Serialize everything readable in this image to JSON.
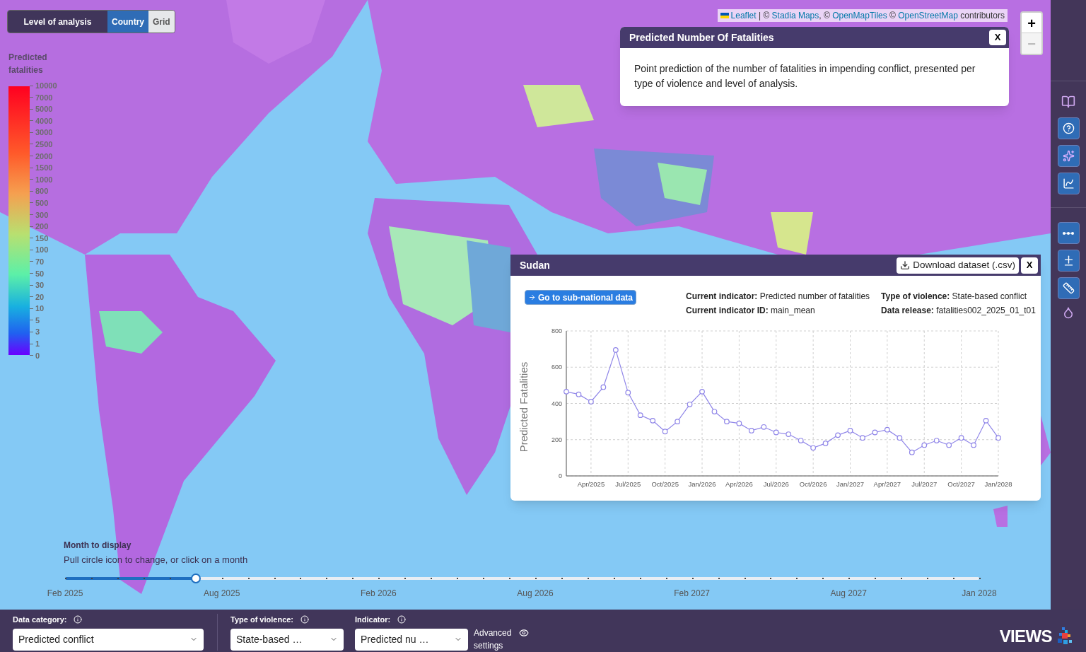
{
  "level_toggle": {
    "label": "Level of analysis",
    "options": [
      {
        "label": "Country",
        "selected": true
      },
      {
        "label": "Grid",
        "selected": false
      }
    ]
  },
  "legend": {
    "title": "Predicted fatalities",
    "labels": [
      "10000",
      "7000",
      "5000",
      "4000",
      "3000",
      "2500",
      "2000",
      "1500",
      "1000",
      "800",
      "500",
      "300",
      "200",
      "150",
      "100",
      "70",
      "50",
      "30",
      "20",
      "10",
      "5",
      "3",
      "1",
      "0"
    ]
  },
  "attribution": [
    {
      "kind": "link",
      "text": "Leaflet"
    },
    {
      "kind": "text",
      "text": " | © "
    },
    {
      "kind": "link",
      "text": "Stadia Maps"
    },
    {
      "kind": "text",
      "text": ", © "
    },
    {
      "kind": "link",
      "text": "OpenMapTiles"
    },
    {
      "kind": "text",
      "text": " © "
    },
    {
      "kind": "link",
      "text": "OpenStreetMap"
    },
    {
      "kind": "text",
      "text": " contributors"
    }
  ],
  "zoom": {
    "in": "+",
    "out": "−",
    "out_disabled": true
  },
  "info_popup": {
    "title": "Predicted Number Of Fatalities",
    "close": "X",
    "body": "Point prediction of the number of fatalities in impending conflict, presented per type of violence and level of analysis."
  },
  "country_panel": {
    "title": "Sudan",
    "download": "Download dataset (.csv)",
    "close": "X",
    "subnational": "Go to sub-national data",
    "meta": [
      {
        "label": "Current indicator:",
        "value": "Predicted number of fatalities"
      },
      {
        "label": "Type of violence:",
        "value": "State-based conflict"
      },
      {
        "label": "Current indicator ID:",
        "value": "main_mean"
      },
      {
        "label": "Data release:",
        "value": "fatalities002_2025_01_t01"
      }
    ],
    "chart_data": {
      "type": "line",
      "ylabel": "Predicted Fatalities",
      "ylim": [
        0,
        800
      ],
      "yticks": [
        0,
        200,
        400,
        600,
        800
      ],
      "grid": true,
      "categories": [
        null,
        null,
        "Apr/2025",
        null,
        null,
        "Jul/2025",
        null,
        null,
        "Oct/2025",
        null,
        null,
        "Jan/2026",
        null,
        null,
        "Apr/2026",
        null,
        null,
        "Jul/2026",
        null,
        null,
        "Oct/2026",
        null,
        null,
        "Jan/2027",
        null,
        null,
        "Apr/2027",
        null,
        null,
        "Jul/2027",
        null,
        null,
        "Oct/2027",
        null,
        null,
        "Jan/2028"
      ],
      "series": [
        {
          "color": "#8f85e8",
          "marker": "circle",
          "values": [
            465,
            450,
            410,
            490,
            695,
            460,
            335,
            305,
            245,
            300,
            395,
            465,
            355,
            300,
            290,
            250,
            270,
            240,
            230,
            195,
            155,
            180,
            225,
            250,
            210,
            240,
            255,
            210,
            130,
            170,
            195,
            170,
            210,
            170,
            305,
            210
          ]
        }
      ]
    }
  },
  "month_slider": {
    "title": "Month to display",
    "hint": "Pull circle icon to change, or click on a month",
    "level": 0.143,
    "month_labels": [
      "Feb 2025",
      "Aug 2025",
      "Feb 2026",
      "Aug 2026",
      "Feb 2027",
      "Aug 2027",
      "Jan 2028"
    ]
  },
  "controls": [
    {
      "label": "Data category:",
      "value": "Predicted conflict"
    },
    {
      "label": "Type of violence:",
      "value": "State-based …"
    },
    {
      "label": "Indicator:",
      "value": "Predicted nu …"
    }
  ],
  "advanced_settings": "Advanced settings",
  "logo": "VIEWS"
}
